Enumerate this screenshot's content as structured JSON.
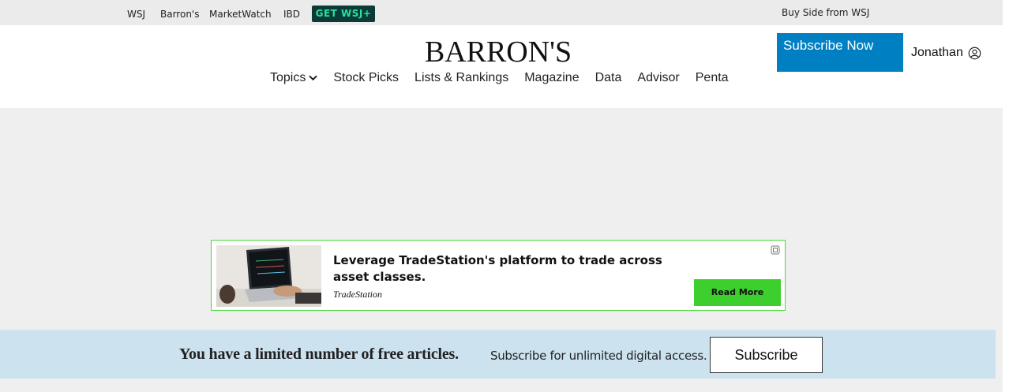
{
  "topbar": {
    "links": [
      "WSJ",
      "Barron's",
      "MarketWatch",
      "IBD"
    ],
    "get_wsj": "GET WSJ+",
    "buy_side": "Buy Side from WSJ"
  },
  "header": {
    "logo": "BARRON'S",
    "subscribe_now": "Subscribe Now",
    "user_name": "Jonathan",
    "user_icon": "user-circle-icon"
  },
  "nav": {
    "items": [
      "Topics",
      "Stock Picks",
      "Lists & Rankings",
      "Magazine",
      "Data",
      "Advisor",
      "Penta"
    ],
    "topics_icon": "chevron-down-icon"
  },
  "ad": {
    "headline": "Leverage TradeStation's platform to trade across asset classes.",
    "brand": "TradeStation",
    "button": "Read More",
    "adchoices_icon": "ad-choices-icon",
    "accent": "#3dcf2d"
  },
  "paywall": {
    "title": "You have a limited number of free articles.",
    "subtitle": "Subscribe for unlimited digital access.",
    "button": "Subscribe"
  },
  "colors": {
    "subscribe_blue": "#0080c3",
    "paywall_bg": "#cce2ef",
    "wsj_dark": "#0c3a38",
    "wsj_green": "#27e39c"
  }
}
